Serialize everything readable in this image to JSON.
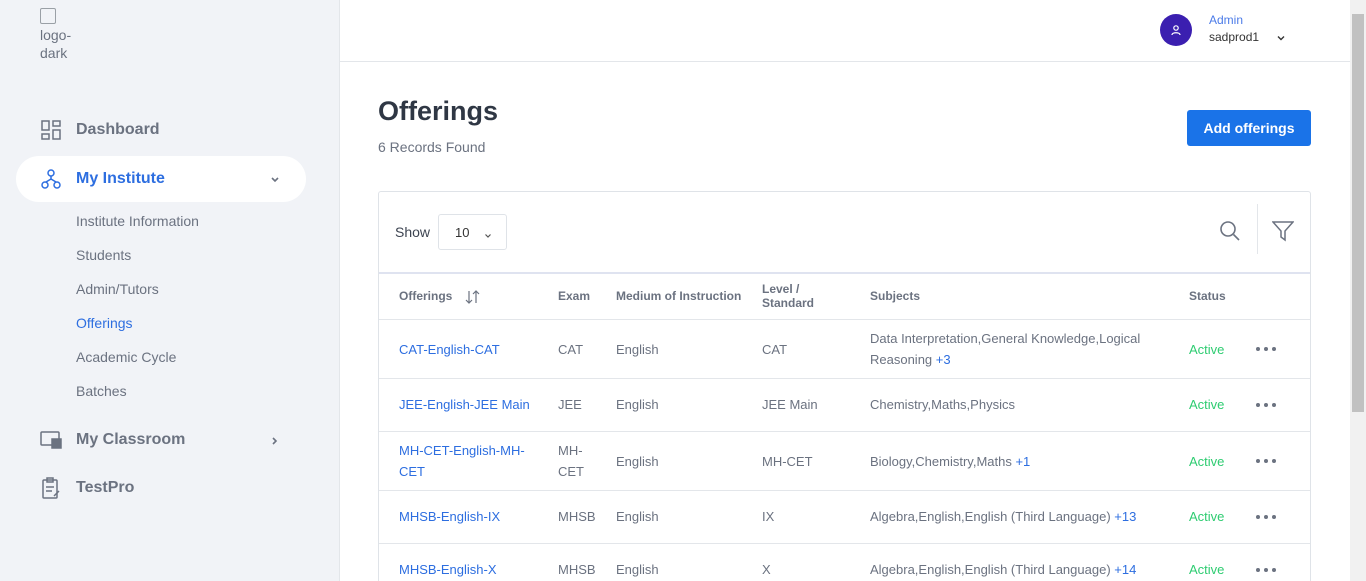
{
  "logo": {
    "alt": "logo-dark"
  },
  "sidebar": {
    "items": [
      {
        "label": "Dashboard",
        "icon": "dashboard-icon"
      },
      {
        "label": "My Institute",
        "icon": "institute-icon",
        "active": true
      },
      {
        "label": "My Classroom",
        "icon": "classroom-icon"
      },
      {
        "label": "TestPro",
        "icon": "clipboard-icon"
      }
    ],
    "sub_items": [
      {
        "label": "Institute Information"
      },
      {
        "label": "Students"
      },
      {
        "label": "Admin/Tutors"
      },
      {
        "label": "Offerings",
        "active": true
      },
      {
        "label": "Academic Cycle"
      },
      {
        "label": "Batches"
      }
    ]
  },
  "header": {
    "role": "Admin",
    "username": "sadprod1"
  },
  "main": {
    "title": "Offerings",
    "records": "6 Records Found",
    "add_button": "Add offerings",
    "show_label": "Show",
    "show_value": "10"
  },
  "table": {
    "columns": [
      "Offerings",
      "Exam",
      "Medium of Instruction",
      "Level / Standard",
      "Subjects",
      "Status"
    ],
    "rows": [
      {
        "offering": "CAT-English-CAT",
        "exam": "CAT",
        "medium": "English",
        "level": "CAT",
        "subjects": "Data Interpretation,General Knowledge,Logical Reasoning",
        "more": "+3",
        "status": "Active"
      },
      {
        "offering": "JEE-English-JEE Main",
        "exam": "JEE",
        "medium": "English",
        "level": "JEE Main",
        "subjects": "Chemistry,Maths,Physics",
        "more": "",
        "status": "Active"
      },
      {
        "offering": "MH-CET-English-MH-CET",
        "exam": "MH-CET",
        "medium": "English",
        "level": "MH-CET",
        "subjects": "Biology,Chemistry,Maths",
        "more": "+1",
        "status": "Active"
      },
      {
        "offering": "MHSB-English-IX",
        "exam": "MHSB",
        "medium": "English",
        "level": "IX",
        "subjects": "Algebra,English,English (Third Language)",
        "more": "+13",
        "status": "Active"
      },
      {
        "offering": "MHSB-English-X",
        "exam": "MHSB",
        "medium": "English",
        "level": "X",
        "subjects": "Algebra,English,English (Third Language)",
        "more": "+14",
        "status": "Active"
      }
    ]
  },
  "colors": {
    "accent": "#1a73e8",
    "link": "#2d6ee0",
    "active_status": "#2ecc71",
    "avatar": "#3b1fb0"
  }
}
